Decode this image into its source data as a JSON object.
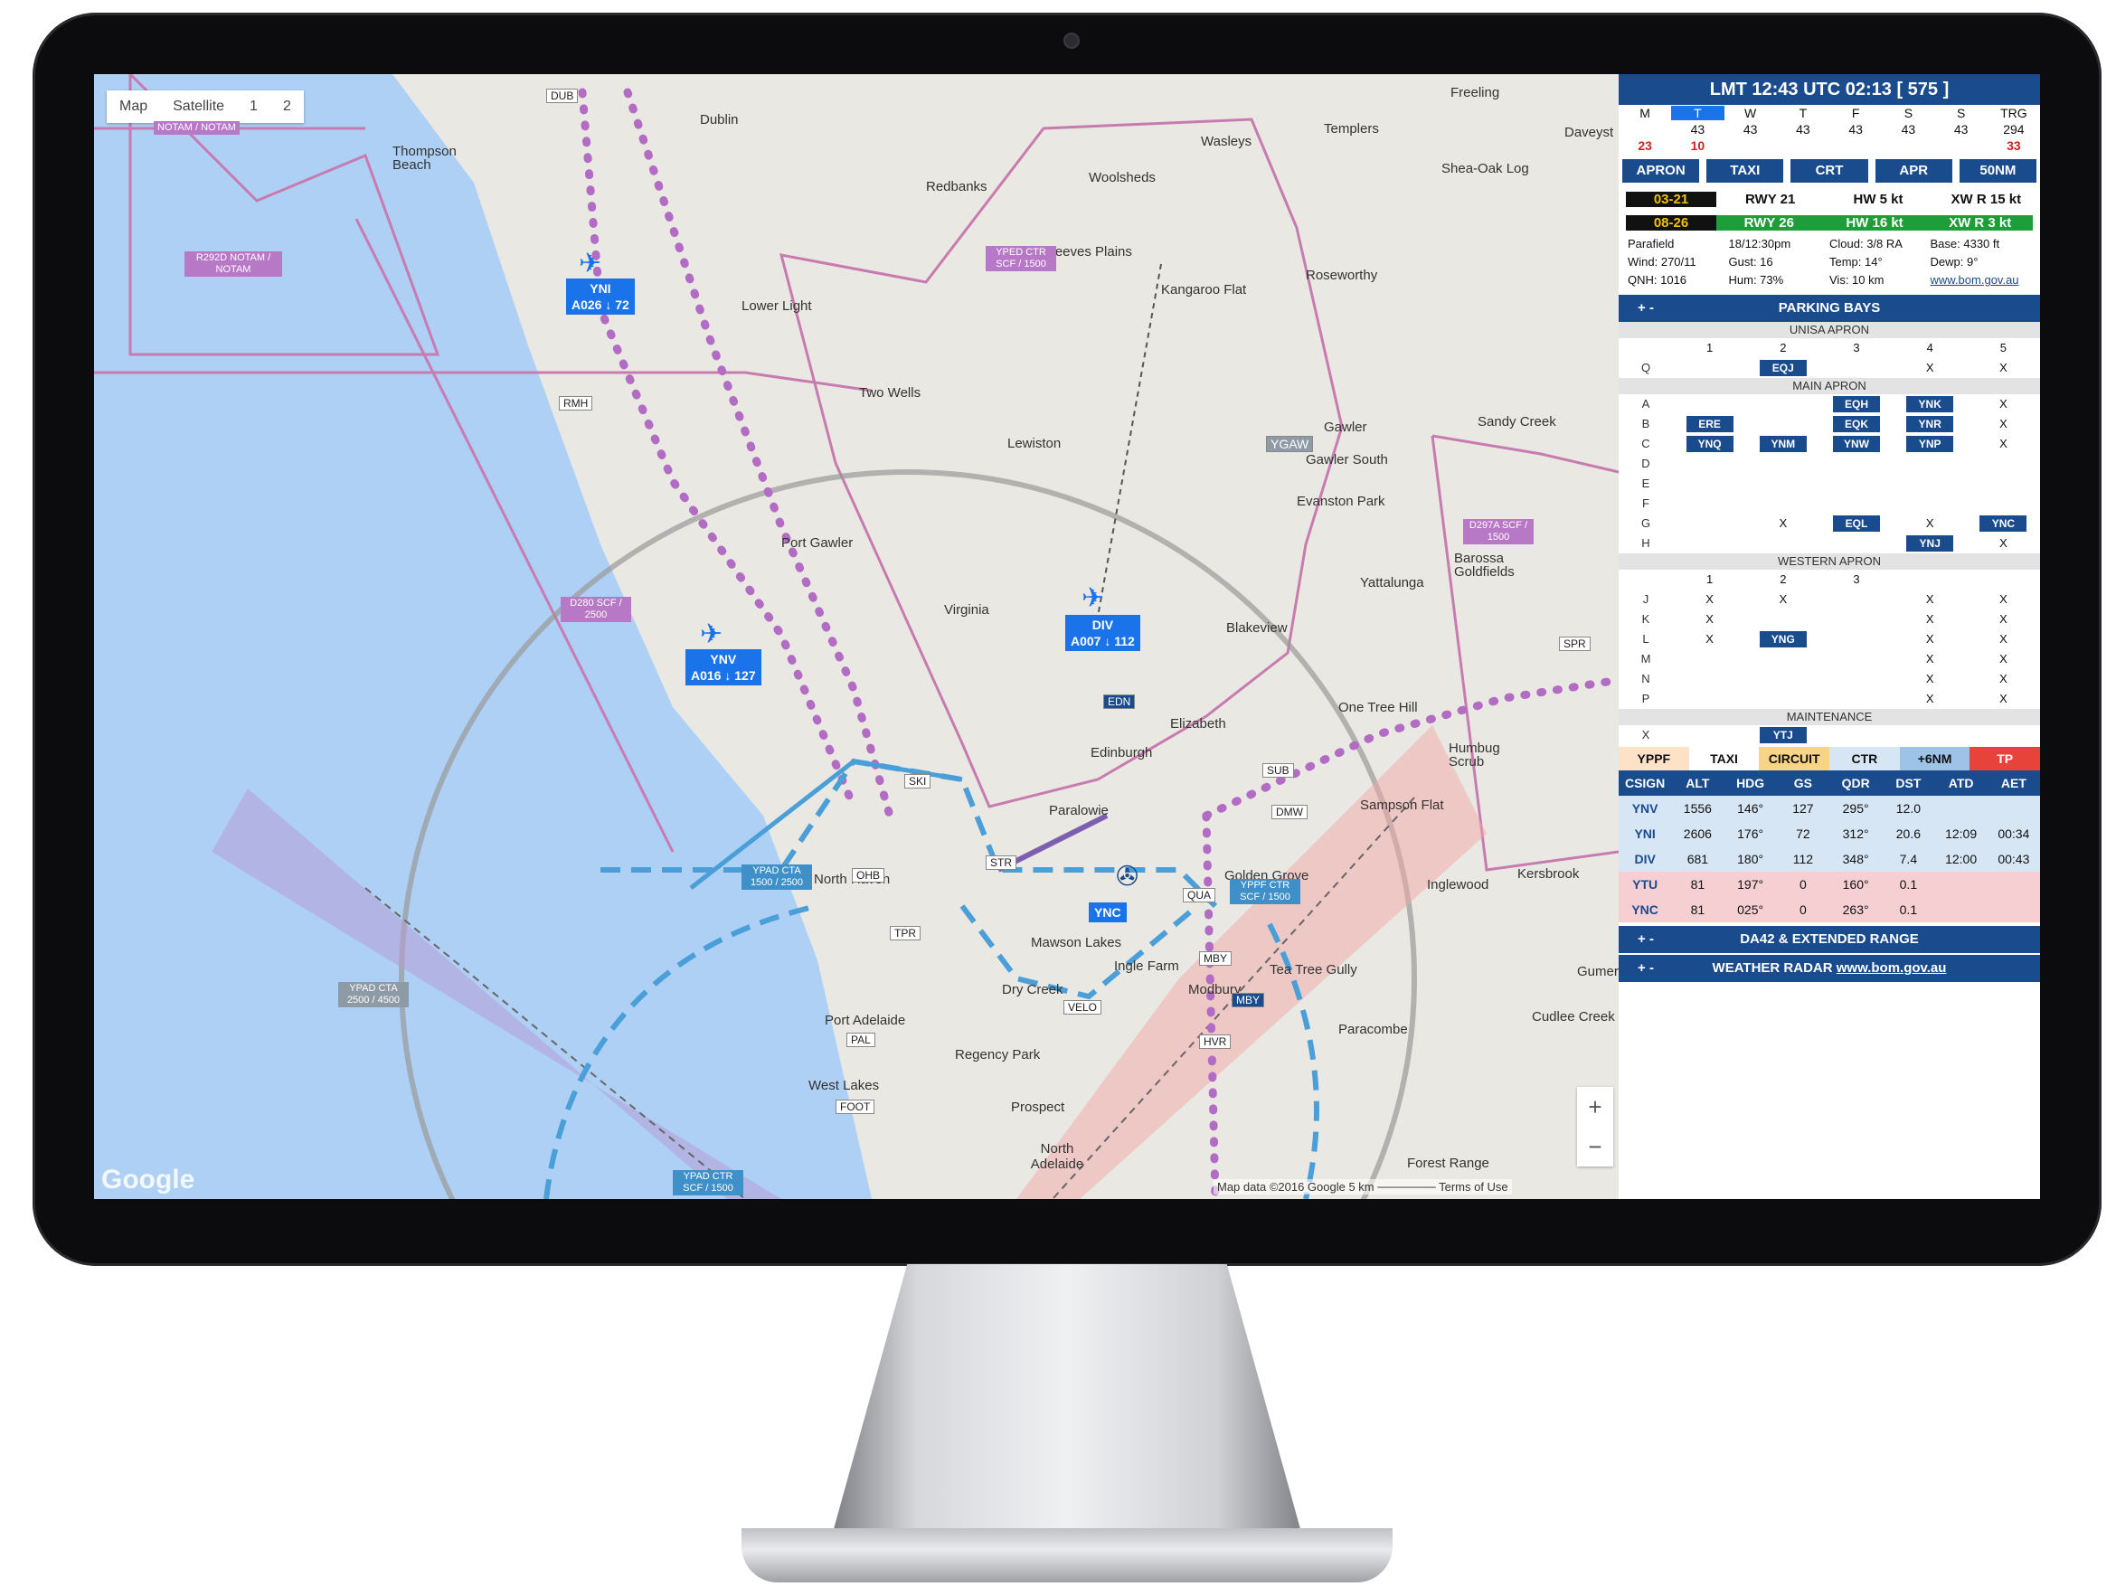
{
  "map": {
    "type_buttons": [
      "Map",
      "Satellite",
      "1",
      "2"
    ],
    "zoom_in": "+",
    "zoom_out": "−",
    "logo": "Google",
    "attribution": "Map data ©2016 Google   5 km ───────   Terms of Use",
    "places": [
      {
        "text": "Dublin"
      },
      {
        "text": "Freeling"
      },
      {
        "text": "Templers"
      },
      {
        "text": "Daveyst"
      },
      {
        "text": "Thompson Beach"
      },
      {
        "text": "Redbanks"
      },
      {
        "text": "Woolsheds"
      },
      {
        "text": "Wasleys"
      },
      {
        "text": "Shea-Oak Log"
      },
      {
        "text": "Reeves Plains"
      },
      {
        "text": "Kangaroo Flat"
      },
      {
        "text": "Roseworthy"
      },
      {
        "text": "Lower Light"
      },
      {
        "text": "Two Wells"
      },
      {
        "text": "Lewiston"
      },
      {
        "text": "Gawler"
      },
      {
        "text": "Gawler South"
      },
      {
        "text": "Sandy Creek"
      },
      {
        "text": "Evanston Park"
      },
      {
        "text": "Port Gawler"
      },
      {
        "text": "Yattalunga"
      },
      {
        "text": "Barossa Goldfields"
      },
      {
        "text": "Virginia"
      },
      {
        "text": "Blakeview"
      },
      {
        "text": "One Tree Hill"
      },
      {
        "text": "Elizabeth"
      },
      {
        "text": "Edinburgh"
      },
      {
        "text": "Humbug Scrub"
      },
      {
        "text": "Paralowie"
      },
      {
        "text": "Sampson Flat"
      },
      {
        "text": "North Haven"
      },
      {
        "text": "Golden Grove"
      },
      {
        "text": "Inglewood"
      },
      {
        "text": "Kersbrook"
      },
      {
        "text": "Mawson Lakes"
      },
      {
        "text": "Ingle Farm"
      },
      {
        "text": "Tea Tree Gully"
      },
      {
        "text": "Dry Creek"
      },
      {
        "text": "Modbury"
      },
      {
        "text": "Port Adelaide"
      },
      {
        "text": "Regency Park"
      },
      {
        "text": "Paracombe"
      },
      {
        "text": "Cudlee Creek"
      },
      {
        "text": "West Lakes"
      },
      {
        "text": "Prospect"
      },
      {
        "text": "North Adelaide"
      },
      {
        "text": "Forest Range"
      },
      {
        "text": "Gumer"
      }
    ],
    "aircraft": [
      {
        "id": "YNI",
        "info": "A026 ↓ 72"
      },
      {
        "id": "YNV",
        "info": "A016 ↓ 127"
      },
      {
        "id": "DIV",
        "info": "A007 ↓ 112"
      },
      {
        "id": "YNC",
        "info": ""
      }
    ],
    "points": [
      "DUB",
      "RMH",
      "SKI",
      "STR",
      "OHB",
      "TPR",
      "PAL",
      "FOOT",
      "VELO",
      "MBY",
      "HVR",
      "QUA",
      "SUB",
      "DMW",
      "SPR",
      "EDN",
      "MBY",
      "YGAW"
    ],
    "airspace": [
      {
        "text": "NOTAM / NOTAM"
      },
      {
        "text": "R292D NOTAM / NOTAM"
      },
      {
        "text": "YPED CTR SCF / 1500"
      },
      {
        "text": "D280 SCF / 2500"
      },
      {
        "text": "D297A SCF / 1500"
      },
      {
        "text": "YPAD CTA 1500 / 2500"
      },
      {
        "text": "YPPF CTR SCF / 1500"
      },
      {
        "text": "YPAD CTA 2500 / 4500"
      },
      {
        "text": "YPAD CTR SCF / 1500"
      }
    ]
  },
  "panel": {
    "clock": "LMT  12:43  UTC  02:13   [ 575 ]",
    "days": [
      "M",
      "T",
      "W",
      "T",
      "F",
      "S",
      "S",
      "TRG"
    ],
    "day_values": [
      "",
      "43",
      "43",
      "43",
      "43",
      "43",
      "43",
      "294"
    ],
    "day_red": [
      "23",
      "10",
      "",
      "",
      "",
      "",
      "",
      "33"
    ],
    "mode_buttons": [
      "APRON",
      "TAXI",
      "CRT",
      "APR",
      "50NM"
    ],
    "runways": [
      {
        "rwy": "03-21",
        "name": "RWY 21",
        "hw": "HW 5 kt",
        "xw": "XW R 15 kt"
      },
      {
        "rwy": "08-26",
        "name": "RWY 26",
        "hw": "HW 16 kt",
        "xw": "XW R 3 kt"
      }
    ],
    "weather": [
      [
        "Parafield",
        "18/12:30pm",
        "Cloud: 3/8 RA",
        "Base: 4330 ft"
      ],
      [
        "Wind: 270/11",
        "Gust: 16",
        "Temp: 14°",
        "Dewp: 9°"
      ],
      [
        "QNH: 1016",
        "Hum: 73%",
        "Vis: 10 km",
        "www.bom.gov.au"
      ]
    ],
    "parking_title": "PARKING BAYS",
    "toggle": "+ -",
    "unisa_title": "UNISA APRON",
    "unisa_cols": [
      "1",
      "2",
      "3",
      "4",
      "5"
    ],
    "unisa_rows": [
      [
        "Q",
        "",
        "EQJ",
        "",
        "X",
        "X"
      ]
    ],
    "main_title": "MAIN APRON",
    "main_rows": [
      [
        "A",
        "",
        "",
        "EQH",
        "YNK",
        "X"
      ],
      [
        "B",
        "ERE",
        "",
        "EQK",
        "YNR",
        "X"
      ],
      [
        "C",
        "YNQ",
        "YNM",
        "YNW",
        "YNP",
        "X"
      ],
      [
        "D",
        "",
        "",
        "",
        "",
        ""
      ],
      [
        "E",
        "",
        "",
        "",
        "",
        ""
      ],
      [
        "F",
        "",
        "",
        "",
        "",
        ""
      ],
      [
        "G",
        "",
        "X",
        "EQL",
        "X",
        "YNC"
      ],
      [
        "H",
        "",
        "",
        "",
        "YNJ",
        "X"
      ]
    ],
    "western_title": "WESTERN APRON",
    "western_cols": [
      "1",
      "2",
      "3",
      "",
      ""
    ],
    "western_rows": [
      [
        "J",
        "X",
        "X",
        "",
        "X",
        "X"
      ],
      [
        "K",
        "X",
        "",
        "",
        "X",
        "X"
      ],
      [
        "L",
        "X",
        "YNG",
        "",
        "X",
        "X"
      ],
      [
        "M",
        "",
        "",
        "",
        "X",
        "X"
      ],
      [
        "N",
        "",
        "",
        "",
        "X",
        "X"
      ],
      [
        "P",
        "",
        "",
        "",
        "X",
        "X"
      ]
    ],
    "maint_title": "MAINTENANCE",
    "maint_row": [
      "X",
      "YTJ"
    ],
    "filters": [
      "YPPF",
      "TAXI",
      "CIRCUIT",
      "CTR",
      "+6NM",
      "TP"
    ],
    "table_headers": [
      "CSIGN",
      "ALT",
      "HDG",
      "GS",
      "QDR",
      "DST",
      "ATD",
      "AET"
    ],
    "table_rows": [
      [
        "YNV",
        "1556",
        "146°",
        "127",
        "295°",
        "12.0",
        "",
        ""
      ],
      [
        "YNI",
        "2606",
        "176°",
        "72",
        "312°",
        "20.6",
        "12:09",
        "00:34"
      ],
      [
        "DIV",
        "681",
        "180°",
        "112",
        "348°",
        "7.4",
        "12:00",
        "00:43"
      ],
      [
        "YTU",
        "81",
        "197°",
        "0",
        "160°",
        "0.1",
        "",
        ""
      ],
      [
        "YNC",
        "81",
        "025°",
        "0",
        "263°",
        "0.1",
        "",
        ""
      ]
    ],
    "section_da42": "DA42 & EXTENDED RANGE",
    "section_radar": "WEATHER RADAR",
    "radar_link": "www.bom.gov.au"
  },
  "colors": {
    "panel_blue": "#1a4b8c",
    "sea": "#aed0f4",
    "airspace": "#c77bb0",
    "route": "#b26cc4",
    "approach": "#4a9fd8"
  }
}
